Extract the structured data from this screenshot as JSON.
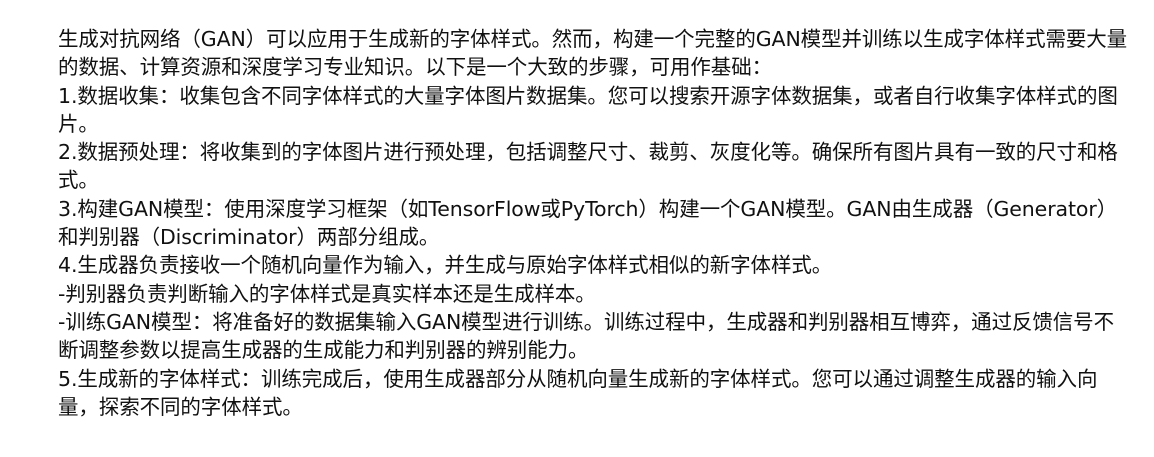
{
  "document": {
    "paragraphs": [
      "生成对抗网络（GAN）可以应用于生成新的字体样式。然而，构建一个完整的GAN模型并训练以生成字体样式需要大量的数据、计算资源和深度学习专业知识。以下是一个大致的步骤，可用作基础：",
      "1.数据收集：收集包含不同字体样式的大量字体图片数据集。您可以搜索开源字体数据集，或者自行收集字体样式的图片。",
      "2.数据预处理：将收集到的字体图片进行预处理，包括调整尺寸、裁剪、灰度化等。确保所有图片具有一致的尺寸和格式。",
      "3.构建GAN模型：使用深度学习框架（如TensorFlow或PyTorch）构建一个GAN模型。GAN由生成器（Generator）和判别器（Discriminator）两部分组成。",
      "4.生成器负责接收一个随机向量作为输入，并生成与原始字体样式相似的新字体样式。",
      "-判别器负责判断输入的字体样式是真实样本还是生成样本。",
      "-训练GAN模型：将准备好的数据集输入GAN模型进行训练。训练过程中，生成器和判别器相互博弈，通过反馈信号不断调整参数以提高生成器的生成能力和判别器的辨别能力。",
      "5.生成新的字体样式：训练完成后，使用生成器部分从随机向量生成新的字体样式。您可以通过调整生成器的输入向量，探索不同的字体样式。"
    ]
  }
}
